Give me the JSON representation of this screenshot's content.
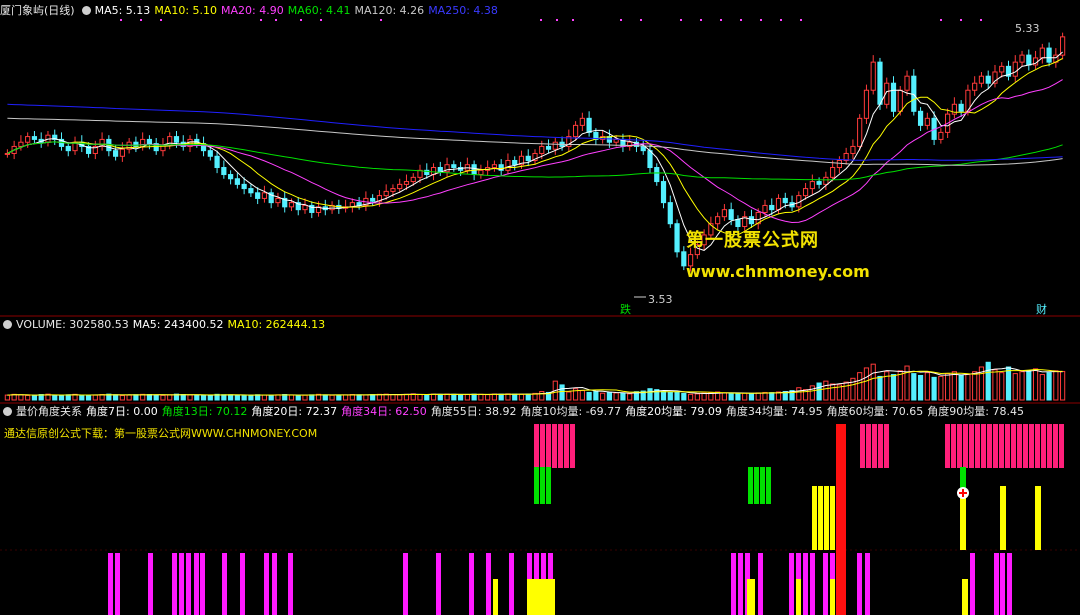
{
  "main_header": {
    "title": "厦门象屿(日线)",
    "ma5": "MA5: 5.13",
    "ma10": "MA10: 5.10",
    "ma20": "MA20: 4.90",
    "ma60": "MA60: 4.41",
    "ma120": "MA120: 4.26",
    "ma250": "MA250: 4.38"
  },
  "price_annotations": {
    "high": "5.33",
    "low": "3.53",
    "signal_down": "跌",
    "signal_cai": "财"
  },
  "watermark": {
    "line1": "第一股票公式网",
    "line2": "www.chnmoney.com"
  },
  "volume_header": {
    "volume": "VOLUME: 302580.53",
    "ma5": "MA5: 243400.52",
    "ma10": "MA10: 262444.13"
  },
  "indicator_header": {
    "title": "量价角度关系",
    "a7": "角度7日: 0.00",
    "a13": "角度13日: 70.12",
    "a20": "角度20日: 72.37",
    "a34": "角度34日: 62.50",
    "a55": "角度55日: 38.92",
    "v10": "角度10均量: -69.77",
    "v20": "角度20均量: 79.09",
    "v34": "角度34均量: 74.95",
    "v60": "角度60均量: 70.65",
    "v90": "角度90均量: 78.45"
  },
  "indicator_note": "通达信原创公式下载：第一股票公式网WWW.CHNMONEY.COM",
  "colors": {
    "up": "#ff3b3b",
    "down": "#54f0ff",
    "ma5": "#ffffff",
    "ma10": "#ffff00",
    "ma20": "#ff40ff",
    "ma60": "#00e000",
    "ma120": "#c8c8c8",
    "ma250": "#2020ff",
    "pink": "#ff1f7a",
    "magenta": "#ff1aff",
    "green": "#00e000",
    "yellow": "#ffff00",
    "red": "#ff1010"
  },
  "chart_data": {
    "type": "candlestick",
    "price_range": [
      3.4,
      5.45
    ],
    "closes": [
      4.5,
      4.55,
      4.58,
      4.62,
      4.6,
      4.58,
      4.63,
      4.6,
      4.55,
      4.52,
      4.58,
      4.55,
      4.5,
      4.55,
      4.6,
      4.52,
      4.48,
      4.53,
      4.58,
      4.55,
      4.6,
      4.57,
      4.52,
      4.56,
      4.62,
      4.58,
      4.55,
      4.6,
      4.57,
      4.52,
      4.48,
      4.4,
      4.35,
      4.32,
      4.28,
      4.25,
      4.22,
      4.18,
      4.22,
      4.15,
      4.18,
      4.12,
      4.15,
      4.1,
      4.13,
      4.08,
      4.12,
      4.1,
      4.13,
      4.11,
      4.12,
      4.15,
      4.13,
      4.18,
      4.16,
      4.2,
      4.23,
      4.25,
      4.28,
      4.3,
      4.33,
      4.38,
      4.35,
      4.4,
      4.37,
      4.42,
      4.4,
      4.38,
      4.42,
      4.35,
      4.38,
      4.4,
      4.42,
      4.38,
      4.45,
      4.42,
      4.48,
      4.45,
      4.5,
      4.55,
      4.53,
      4.58,
      4.55,
      4.62,
      4.7,
      4.75,
      4.65,
      4.6,
      4.62,
      4.58,
      4.6,
      4.55,
      4.58,
      4.55,
      4.52,
      4.4,
      4.3,
      4.15,
      4.0,
      3.8,
      3.7,
      3.78,
      3.85,
      3.92,
      4.0,
      4.05,
      4.1,
      4.03,
      3.98,
      4.05,
      4.0,
      4.08,
      4.13,
      4.1,
      4.18,
      4.15,
      4.12,
      4.2,
      4.25,
      4.3,
      4.28,
      4.33,
      4.4,
      4.45,
      4.5,
      4.55,
      4.75,
      4.95,
      5.15,
      4.85,
      5.0,
      4.8,
      4.95,
      5.05,
      4.8,
      4.7,
      4.75,
      4.6,
      4.65,
      4.78,
      4.85,
      4.8,
      4.95,
      5.0,
      5.05,
      5.0,
      5.08,
      5.12,
      5.05,
      5.15,
      5.2,
      5.13,
      5.18,
      5.25,
      5.15,
      5.2,
      5.33
    ],
    "volume_range": [
      0,
      700000
    ],
    "volumes": [
      52000,
      60000,
      55000,
      48000,
      45000,
      58000,
      62000,
      50000,
      47000,
      55000,
      60000,
      53000,
      49000,
      51000,
      58000,
      62000,
      55000,
      47000,
      52000,
      56000,
      60000,
      58000,
      51000,
      49000,
      55000,
      62000,
      58000,
      53000,
      50000,
      48000,
      52000,
      60000,
      56000,
      55000,
      50000,
      48000,
      52000,
      56000,
      53000,
      50000,
      55000,
      58000,
      52000,
      49000,
      51000,
      55000,
      60000,
      54000,
      50000,
      52000,
      54000,
      58000,
      55000,
      53000,
      57000,
      60000,
      62000,
      58000,
      55000,
      60000,
      65000,
      58000,
      56000,
      62000,
      59000,
      63000,
      60000,
      55000,
      58000,
      62000,
      60000,
      57000,
      63000,
      61000,
      65000,
      62000,
      60000,
      63000,
      70000,
      90000,
      80000,
      200000,
      160000,
      85000,
      120000,
      100000,
      80000,
      90000,
      72000,
      80000,
      75000,
      70000,
      65000,
      88000,
      95000,
      120000,
      110000,
      90000,
      85000,
      80000,
      70000,
      60000,
      65000,
      72000,
      80000,
      85000,
      75000,
      70000,
      68000,
      72000,
      70000,
      75000,
      80000,
      78000,
      85000,
      90000,
      100000,
      130000,
      110000,
      150000,
      180000,
      200000,
      170000,
      160000,
      190000,
      230000,
      290000,
      340000,
      380000,
      250000,
      300000,
      270000,
      310000,
      360000,
      280000,
      260000,
      290000,
      240000,
      250000,
      280000,
      300000,
      260000,
      270000,
      300000,
      350000,
      400000,
      320000,
      290000,
      350000,
      280000,
      300000,
      310000,
      330000,
      270000,
      290000,
      310000,
      302580
    ]
  }
}
